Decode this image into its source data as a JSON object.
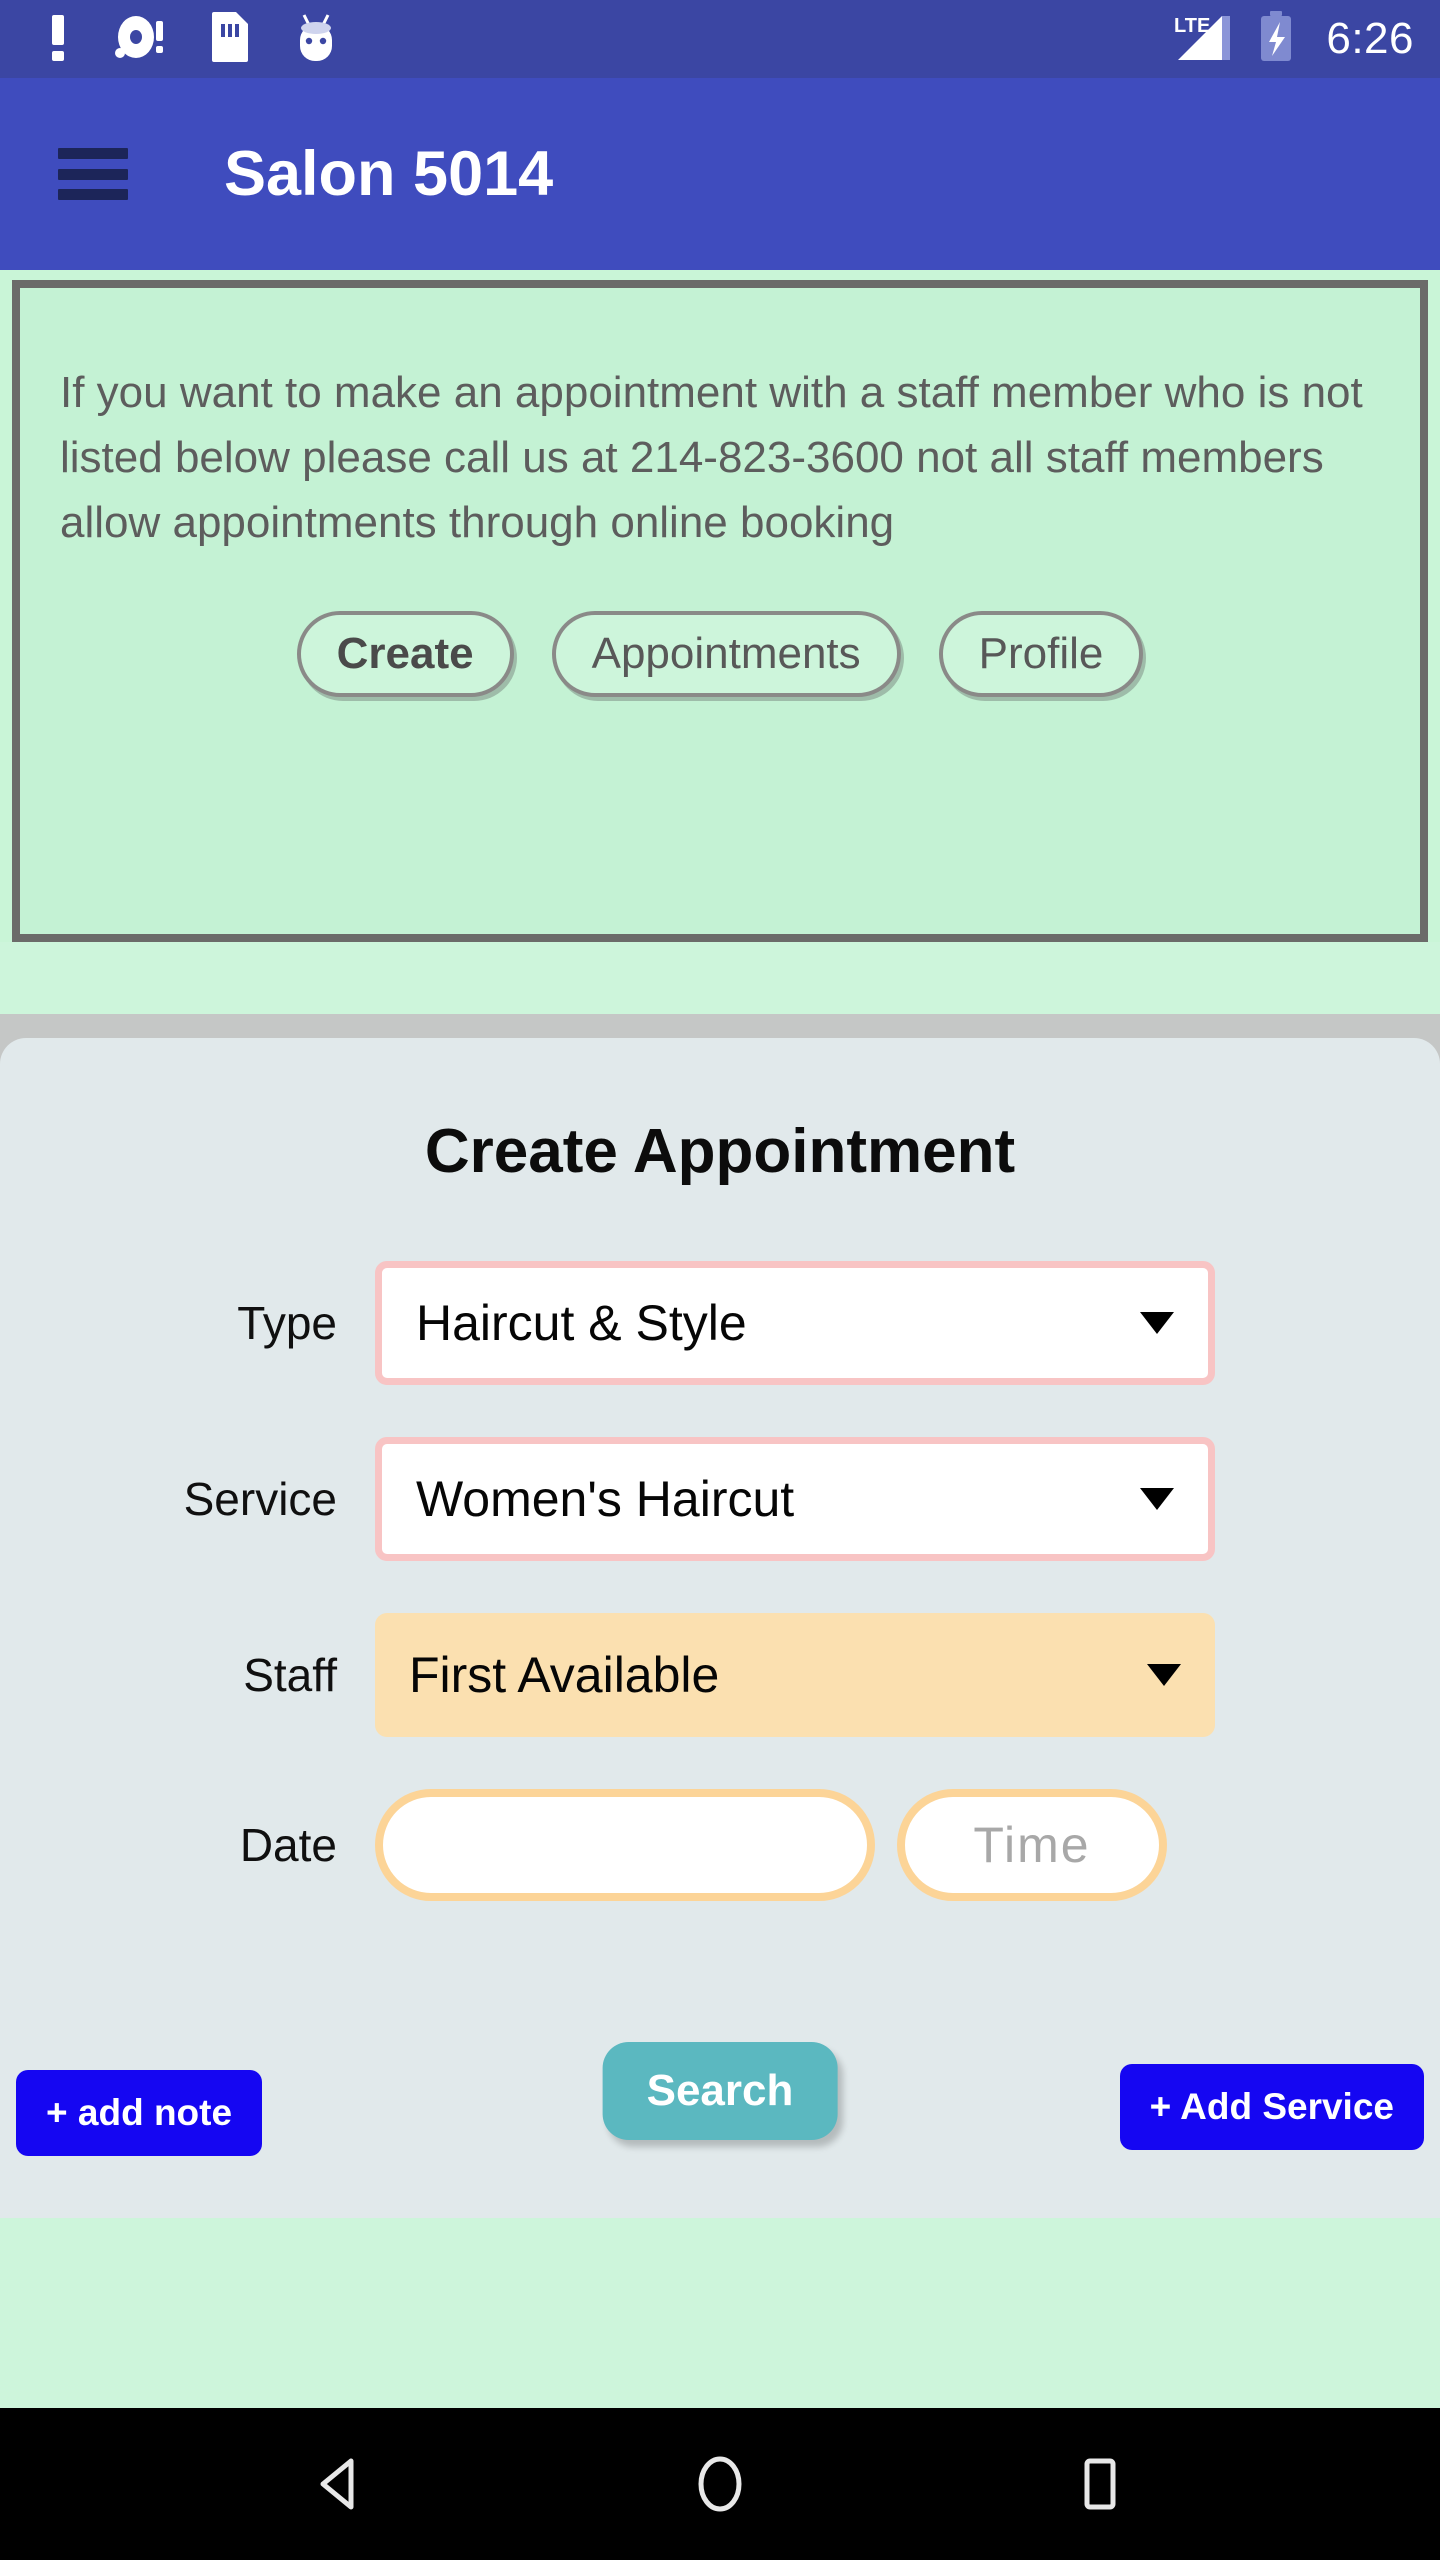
{
  "status_bar": {
    "icons": [
      "warning-icon",
      "sd-alert-icon",
      "sim-card-icon",
      "android-icon"
    ],
    "network": "LTE",
    "battery": "charging-battery-icon",
    "time": "6:26"
  },
  "app_bar": {
    "menu_icon": "hamburger-menu-icon",
    "title": "Salon 5014"
  },
  "banner": {
    "message": "If you want to make an appointment with a staff member who is not listed below please call us at 214-823-3600 not all staff members allow appointments through online booking",
    "phone": "214-823-3600",
    "tabs": [
      {
        "label": "Create",
        "active": true
      },
      {
        "label": "Appointments",
        "active": false
      },
      {
        "label": "Profile",
        "active": false
      }
    ]
  },
  "form": {
    "title": "Create Appointment",
    "fields": {
      "type": {
        "label": "Type",
        "value": "Haircut & Style",
        "style": "pink"
      },
      "service": {
        "label": "Service",
        "value": "Women's Haircut",
        "style": "pink"
      },
      "staff": {
        "label": "Staff",
        "value": "First Available",
        "style": "peach"
      },
      "date": {
        "label": "Date",
        "value": "",
        "placeholder": ""
      },
      "time": {
        "value": "",
        "placeholder": "Time"
      }
    },
    "buttons": {
      "add_note": "+ add note",
      "search": "Search",
      "add_service": "+ Add Service"
    }
  },
  "nav_bar": {
    "back": "back-triangle-icon",
    "home": "home-circle-icon",
    "recents": "recents-square-icon"
  },
  "colors": {
    "status_bar": "#3b46a3",
    "app_bar": "#3f4cbe",
    "banner_bg": "#c4f2d4",
    "page_bg": "#cdf5db",
    "card_bg": "#e1e9eb",
    "accent_pink": "#f8c4c4",
    "accent_peach": "#fbe0b0",
    "accent_orange": "#fcd497",
    "btn_blue": "#1506f2",
    "btn_teal": "#5bb8c0"
  }
}
